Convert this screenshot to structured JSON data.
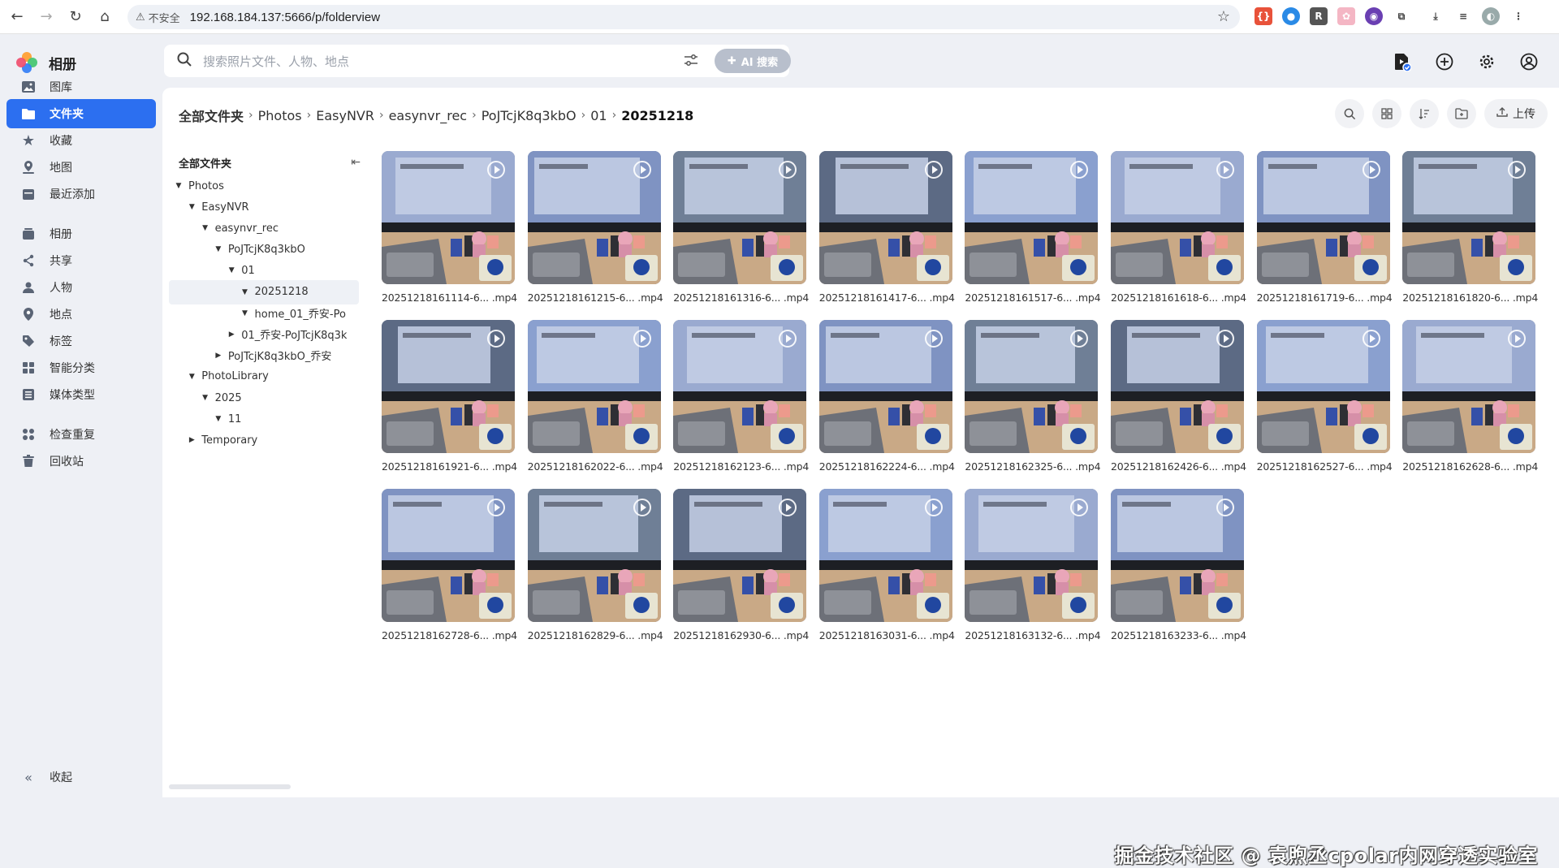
{
  "browser": {
    "insecure_label": "不安全",
    "url": "192.168.184.137:5666/p/folderview"
  },
  "app": {
    "title": "相册"
  },
  "sidebar": {
    "items": [
      {
        "label": "图库",
        "icon": "image-icon"
      },
      {
        "label": "文件夹",
        "icon": "folder-icon",
        "active": true
      },
      {
        "label": "收藏",
        "icon": "star-icon"
      },
      {
        "label": "地图",
        "icon": "map-icon"
      },
      {
        "label": "最近添加",
        "icon": "calendar-icon"
      },
      {
        "label": "相册",
        "icon": "album-icon"
      },
      {
        "label": "共享",
        "icon": "share-icon"
      },
      {
        "label": "人物",
        "icon": "person-icon"
      },
      {
        "label": "地点",
        "icon": "location-icon"
      },
      {
        "label": "标签",
        "icon": "tag-icon"
      },
      {
        "label": "智能分类",
        "icon": "smart-category-icon"
      },
      {
        "label": "媒体类型",
        "icon": "media-type-icon"
      },
      {
        "label": "检查重复",
        "icon": "duplicate-icon"
      },
      {
        "label": "回收站",
        "icon": "trash-icon"
      }
    ],
    "collapse_label": "收起"
  },
  "search": {
    "placeholder": "搜索照片文件、人物、地点",
    "ai_label": "AI 搜索"
  },
  "breadcrumb": [
    "全部文件夹",
    "Photos",
    "EasyNVR",
    "easynvr_rec",
    "PoJTcjK8q3kbO",
    "01",
    "20251218"
  ],
  "toolbar": {
    "upload_label": "上传"
  },
  "tree": {
    "title": "全部文件夹",
    "rows": [
      {
        "label": "Photos",
        "depth": 0,
        "caret": "down"
      },
      {
        "label": "EasyNVR",
        "depth": 1,
        "caret": "down"
      },
      {
        "label": "easynvr_rec",
        "depth": 2,
        "caret": "down"
      },
      {
        "label": "PoJTcjK8q3kbO",
        "depth": 3,
        "caret": "down"
      },
      {
        "label": "01",
        "depth": 4,
        "caret": "down"
      },
      {
        "label": "20251218",
        "depth": 5,
        "caret": "down",
        "selected": true
      },
      {
        "label": "home_01_乔安-Po",
        "depth": 5,
        "caret": "down"
      },
      {
        "label": "01_乔安-PoJTcjK8q3k",
        "depth": 4,
        "caret": "right"
      },
      {
        "label": "PoJTcjK8q3kbO_乔安",
        "depth": 3,
        "caret": "right"
      },
      {
        "label": "PhotoLibrary",
        "depth": 1,
        "caret": "down"
      },
      {
        "label": "2025",
        "depth": 2,
        "caret": "down"
      },
      {
        "label": "11",
        "depth": 3,
        "caret": "down"
      },
      {
        "label": "Temporary",
        "depth": 1,
        "caret": "right"
      }
    ]
  },
  "files": [
    "20251218161114-6... .mp4",
    "20251218161215-6... .mp4",
    "20251218161316-6... .mp4",
    "20251218161417-6... .mp4",
    "20251218161517-6... .mp4",
    "20251218161618-6... .mp4",
    "20251218161719-6... .mp4",
    "20251218161820-6... .mp4",
    "20251218161921-6... .mp4",
    "20251218162022-6... .mp4",
    "20251218162123-6... .mp4",
    "20251218162224-6... .mp4",
    "20251218162325-6... .mp4",
    "20251218162426-6... .mp4",
    "20251218162527-6... .mp4",
    "20251218162628-6... .mp4",
    "20251218162728-6... .mp4",
    "20251218162829-6... .mp4",
    "20251218162930-6... .mp4",
    "20251218163031-6... .mp4",
    "20251218163132-6... .mp4",
    "20251218163233-6... .mp4"
  ],
  "watermark": "掘金技术社区 @ 袁煦丞cpolar内网穿透实验室",
  "colors": {
    "accent": "#2c6ff0",
    "sidebar_bg": "#eef0f5"
  }
}
